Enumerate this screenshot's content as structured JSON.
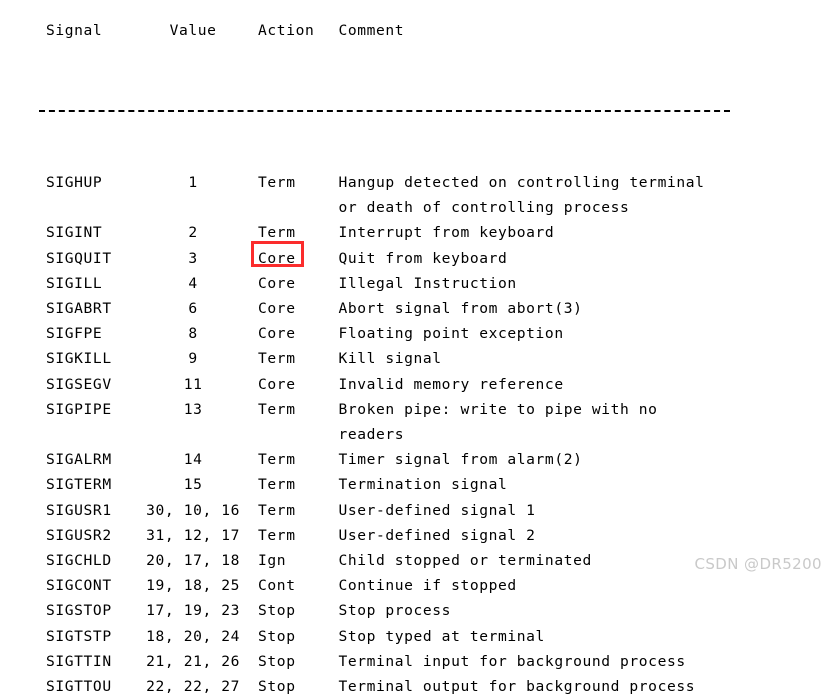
{
  "page": {
    "background_color": "#ffffff",
    "text_color": "#000000",
    "separator": "--------------------------------------------------------------"
  },
  "table": {
    "headers": {
      "signal": "Signal",
      "value": "Value",
      "action": "Action",
      "comment": "Comment"
    },
    "rows": [
      {
        "signal": "SIGHUP",
        "value": "1",
        "action": "Term",
        "comment": "Hangup detected on controlling terminal",
        "comment_cont": "or death of controlling process",
        "highlight": false,
        "space_before": false
      },
      {
        "signal": "SIGINT",
        "value": "2",
        "action": "Term",
        "comment": "Interrupt from keyboard",
        "comment_cont": "",
        "highlight": false,
        "space_before": false
      },
      {
        "signal": "SIGQUIT",
        "value": "3",
        "action": "Core",
        "comment": "Quit from keyboard",
        "comment_cont": "",
        "highlight": true,
        "space_before": false
      },
      {
        "signal": "SIGILL",
        "value": "4",
        "action": "Core",
        "comment": "Illegal Instruction",
        "comment_cont": "",
        "highlight": false,
        "space_before": false
      },
      {
        "signal": "SIGABRT",
        "value": "6",
        "action": "Core",
        "comment": "Abort signal from abort(3)",
        "comment_cont": "",
        "highlight": false,
        "space_before": false
      },
      {
        "signal": "SIGFPE",
        "value": "8",
        "action": "Core",
        "comment": "Floating point exception",
        "comment_cont": "",
        "highlight": false,
        "space_before": false
      },
      {
        "signal": "SIGKILL",
        "value": "9",
        "action": "Term",
        "comment": "Kill signal",
        "comment_cont": "",
        "highlight": false,
        "space_before": false
      },
      {
        "signal": "SIGSEGV",
        "value": "11",
        "action": "Core",
        "comment": "Invalid memory reference",
        "comment_cont": "",
        "highlight": false,
        "space_before": false
      },
      {
        "signal": "SIGPIPE",
        "value": "13",
        "action": "Term",
        "comment": "Broken pipe: write to pipe with no",
        "comment_cont": "readers",
        "highlight": false,
        "space_before": false
      },
      {
        "signal": "SIGALRM",
        "value": "14",
        "action": "Term",
        "comment": "Timer signal from alarm(2)",
        "comment_cont": "",
        "highlight": false,
        "space_before": false
      },
      {
        "signal": "SIGTERM",
        "value": "15",
        "action": "Term",
        "comment": "Termination signal",
        "comment_cont": "",
        "highlight": false,
        "space_before": false
      },
      {
        "signal": "SIGUSR1",
        "value": "30, 10, 16",
        "action": "Term",
        "comment": "User-defined signal 1",
        "comment_cont": "",
        "highlight": false,
        "space_before": false
      },
      {
        "signal": "SIGUSR2",
        "value": "31, 12, 17",
        "action": "Term",
        "comment": "User-defined signal 2",
        "comment_cont": "",
        "highlight": false,
        "space_before": false
      },
      {
        "signal": "SIGCHLD",
        "value": "20, 17, 18",
        "action": "Ign",
        "comment": "Child stopped or terminated",
        "comment_cont": "",
        "highlight": false,
        "space_before": false
      },
      {
        "signal": "SIGCONT",
        "value": "19, 18, 25",
        "action": "Cont",
        "comment": "Continue if stopped",
        "comment_cont": "",
        "highlight": false,
        "space_before": false
      },
      {
        "signal": "SIGSTOP",
        "value": "17, 19, 23",
        "action": "Stop",
        "comment": "Stop process",
        "comment_cont": "",
        "highlight": false,
        "space_before": false
      },
      {
        "signal": "SIGTSTP",
        "value": "18, 20, 24",
        "action": "Stop",
        "comment": "Stop typed at terminal",
        "comment_cont": "",
        "highlight": false,
        "space_before": false
      },
      {
        "signal": "SIGTTIN",
        "value": "21, 21, 26",
        "action": "Stop",
        "comment": "Terminal input for background process",
        "comment_cont": "",
        "highlight": false,
        "space_before": false
      },
      {
        "signal": "SIGTTOU",
        "value": "22, 22, 27",
        "action": "Stop",
        "comment": "Terminal output for background process",
        "comment_cont": "",
        "highlight": false,
        "space_before": false
      }
    ]
  },
  "annotation": {
    "highlight_color": "#fb2c2c",
    "highlighted_signal": "SIGQUIT",
    "highlighted_action": "Core"
  },
  "watermark": {
    "text": "CSDN @DR5200",
    "color": "#c9c9c9"
  }
}
